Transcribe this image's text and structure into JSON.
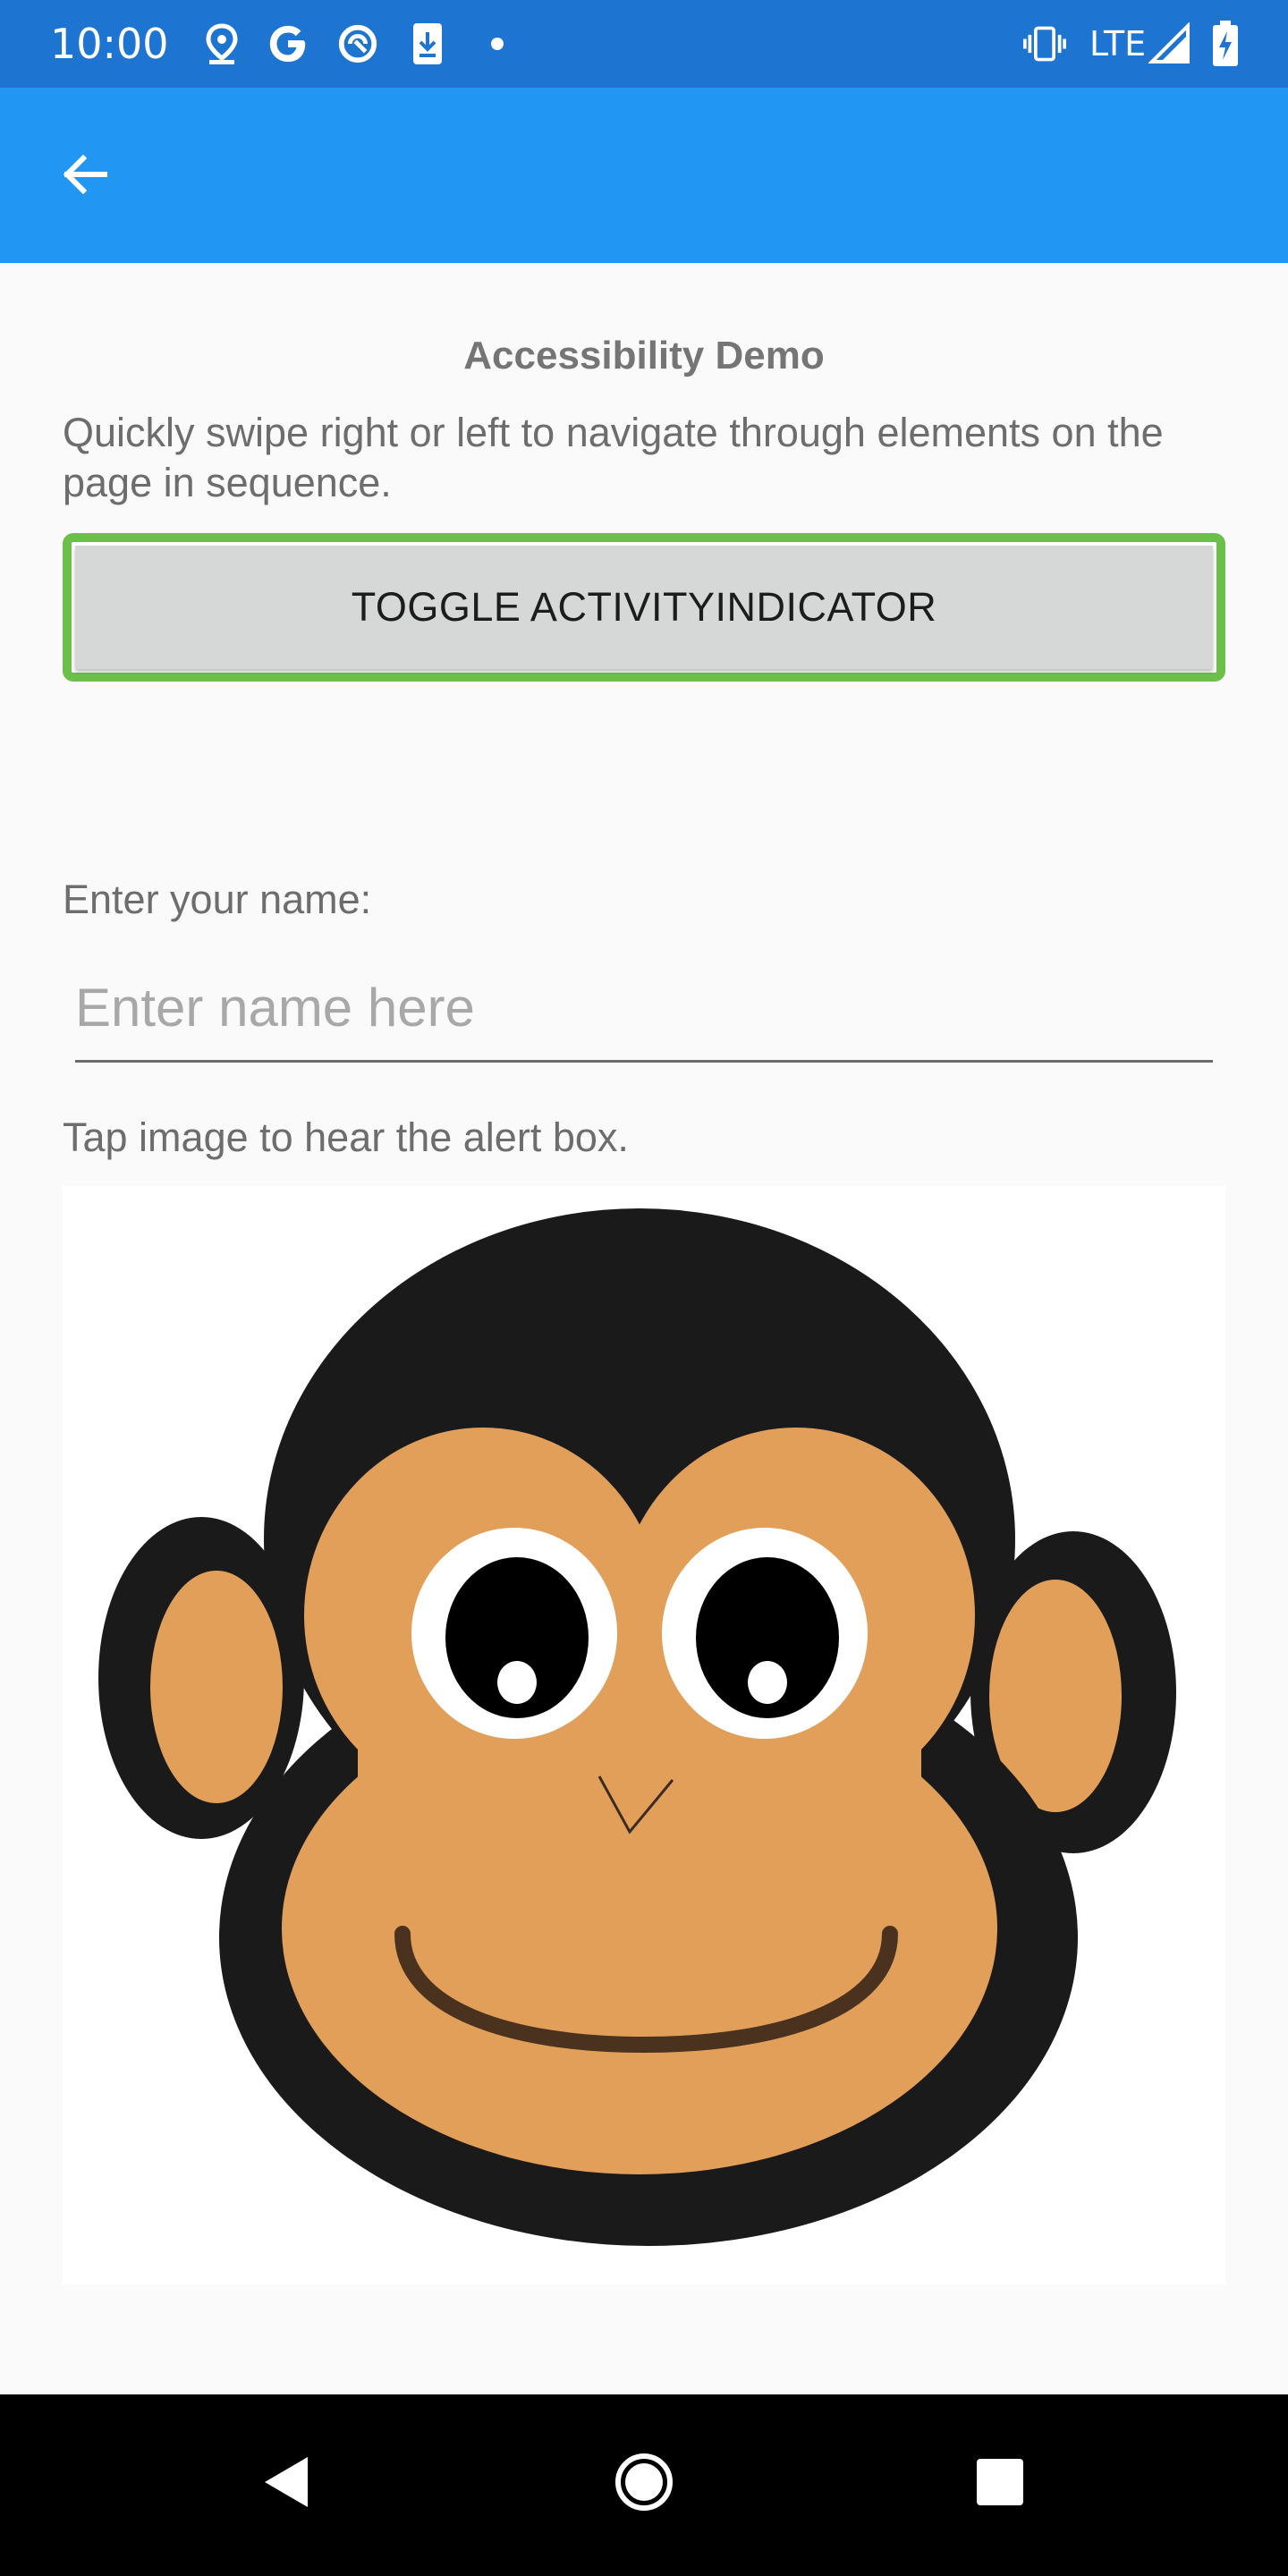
{
  "status_bar": {
    "time": "10:00",
    "icons": [
      "location-pin-icon",
      "google-icon",
      "vpn-icon",
      "download-icon",
      "dot-icon",
      "vibrate-icon",
      "signal-icon",
      "battery-charging-icon"
    ],
    "network": "LTE",
    "background_color": "#1e74d1"
  },
  "app_bar": {
    "back_icon": "arrow-back-icon",
    "background_color": "#2196f3"
  },
  "page": {
    "title": "Accessibility Demo",
    "instructions": "Quickly swipe right or left to navigate through elements on the page in sequence.",
    "toggle_button_label": "TOGGLE ACTIVITYINDICATOR",
    "focus_outline_color": "#6cc04a",
    "name_label": "Enter your name:",
    "name_placeholder": "Enter name here",
    "name_value": "",
    "image_label": "Tap image to hear the alert box.",
    "image_name": "monkey-face"
  },
  "nav_bar": {
    "back_icon": "nav-back-icon",
    "home_icon": "nav-home-icon",
    "recents_icon": "nav-recents-icon"
  }
}
